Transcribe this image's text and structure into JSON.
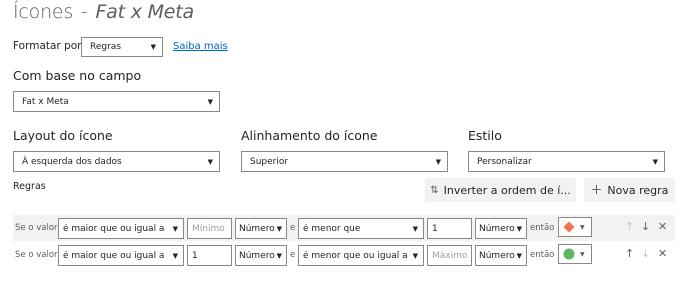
{
  "title": {
    "main": "Ícones",
    "sep": "-",
    "field": "Fat x Meta"
  },
  "format_by": {
    "label": "Formatar por",
    "value": "Regras",
    "learn_more": "Saiba mais"
  },
  "based_on": {
    "label": "Com base no campo",
    "value": "Fat x Meta"
  },
  "icon_layout": {
    "label": "Layout do ícone",
    "value": "À esquerda dos dados"
  },
  "icon_alignment": {
    "label": "Alinhamento do ícone",
    "value": "Superior"
  },
  "style": {
    "label": "Estilo",
    "value": "Personalizar"
  },
  "rules": {
    "label": "Regras",
    "reverse_button": "Inverter a ordem de í...",
    "add_button": "Nova regra",
    "rows": [
      {
        "if_value": "Se o valor",
        "op1": "é maior que ou igual a",
        "value1": "Mínimo",
        "value1_placeholder": true,
        "type1": "Número",
        "and": "e",
        "op2": "é menor que",
        "value2": "1",
        "value2_placeholder": false,
        "type2": "Número",
        "then": "então",
        "icon": "orange-diamond-icon",
        "icon_color": "#f2734e"
      },
      {
        "if_value": "Se o valor",
        "op1": "é maior que ou igual a",
        "value1": "1",
        "value1_placeholder": false,
        "type1": "Número",
        "and": "e",
        "op2": "é menor que ou igual a",
        "value2": "Máximo",
        "value2_placeholder": true,
        "type2": "Número",
        "then": "então",
        "icon": "green-circle-icon",
        "icon_color": "#5cb85c"
      }
    ]
  },
  "colors": {
    "link": "#0062cc",
    "row_bg": "#f3f2f1",
    "border": "#8a8886"
  }
}
